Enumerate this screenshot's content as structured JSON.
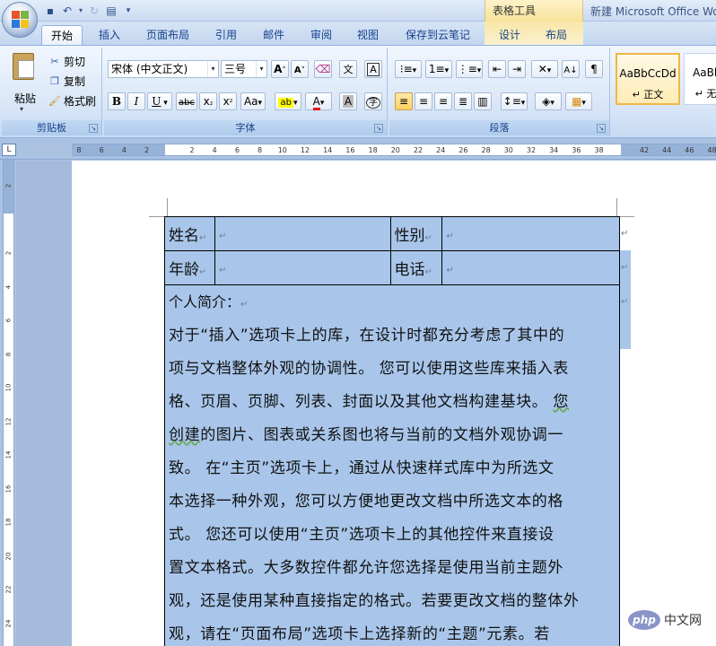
{
  "app_title": "新建 Microsoft Office Wo",
  "table_tools_label": "表格工具",
  "tabs": [
    "开始",
    "插入",
    "页面布局",
    "引用",
    "邮件",
    "审阅",
    "视图",
    "保存到云笔记",
    "设计",
    "布局"
  ],
  "clipboard": {
    "paste": "粘贴",
    "cut": "剪切",
    "copy": "复制",
    "format_painter": "格式刷",
    "group_label": "剪贴板"
  },
  "font": {
    "font_name": "宋体 (中文正文)",
    "font_size": "三号",
    "group_label": "字体"
  },
  "paragraph": {
    "group_label": "段落"
  },
  "styles": [
    {
      "sample": "AaBbCcDd",
      "name": "↵ 正文"
    },
    {
      "sample": "AaBbC",
      "name": "↵ 无间"
    }
  ],
  "ruler_numbers": [
    "8",
    "6",
    "4",
    "2",
    "",
    "2",
    "4",
    "6",
    "8",
    "10",
    "12",
    "14",
    "16",
    "18",
    "20",
    "22",
    "24",
    "26",
    "28",
    "30",
    "32",
    "34",
    "36",
    "38",
    "",
    "42",
    "44",
    "46",
    "48"
  ],
  "vruler_numbers": [
    "2",
    "",
    "2",
    "4",
    "6",
    "8",
    "10",
    "12",
    "14",
    "16",
    "18",
    "20",
    "22",
    "24"
  ],
  "document": {
    "rows": [
      [
        "姓名",
        "",
        "性别",
        ""
      ],
      [
        "年龄",
        "",
        "电话",
        ""
      ]
    ],
    "bio_title": "个人简介：",
    "bio_lines": [
      "对于“插入”选项卡上的库，在设计时都充分考虑了其中的",
      "项与文档整体外观的协调性。 您可以使用这些库来插入表",
      "格、页眉、页脚、列表、封面以及其他文档构建基块。 您",
      "创建的图片、图表或关系图也将与当前的文档外观协调一",
      "致。 在“主页”选项卡上，通过从快速样式库中为所选文",
      "本选择一种外观，您可以方便地更改文档中所选文本的格",
      "式。 您还可以使用“主页”选项卡上的其他控件来直接设",
      "置文本格式。大多数控件都允许您选择是使用当前主题外",
      "观，还是使用某种直接指定的格式。若要更改文档的整体外",
      "观，请在“页面布局”选项卡上选择新的“主题”元素。若"
    ],
    "para_mark": "↵"
  },
  "watermark": {
    "logo": "php",
    "text": "中文网"
  }
}
